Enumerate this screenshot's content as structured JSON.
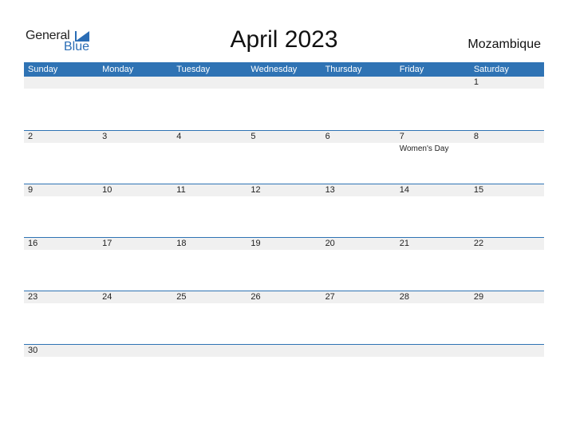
{
  "logo": {
    "line1": "General",
    "line2": "Blue"
  },
  "title": "April 2023",
  "country": "Mozambique",
  "weekdays": [
    "Sunday",
    "Monday",
    "Tuesday",
    "Wednesday",
    "Thursday",
    "Friday",
    "Saturday"
  ],
  "weeks": [
    {
      "days": [
        "",
        "",
        "",
        "",
        "",
        "",
        "1"
      ],
      "events": [
        "",
        "",
        "",
        "",
        "",
        "",
        ""
      ]
    },
    {
      "days": [
        "2",
        "3",
        "4",
        "5",
        "6",
        "7",
        "8"
      ],
      "events": [
        "",
        "",
        "",
        "",
        "",
        "Women's Day",
        ""
      ]
    },
    {
      "days": [
        "9",
        "10",
        "11",
        "12",
        "13",
        "14",
        "15"
      ],
      "events": [
        "",
        "",
        "",
        "",
        "",
        "",
        ""
      ]
    },
    {
      "days": [
        "16",
        "17",
        "18",
        "19",
        "20",
        "21",
        "22"
      ],
      "events": [
        "",
        "",
        "",
        "",
        "",
        "",
        ""
      ]
    },
    {
      "days": [
        "23",
        "24",
        "25",
        "26",
        "27",
        "28",
        "29"
      ],
      "events": [
        "",
        "",
        "",
        "",
        "",
        "",
        ""
      ]
    },
    {
      "days": [
        "30",
        "",
        "",
        "",
        "",
        "",
        ""
      ],
      "events": [
        "",
        "",
        "",
        "",
        "",
        "",
        ""
      ]
    }
  ],
  "colors": {
    "accent": "#2f73b4",
    "strip": "#f0f0f0"
  }
}
